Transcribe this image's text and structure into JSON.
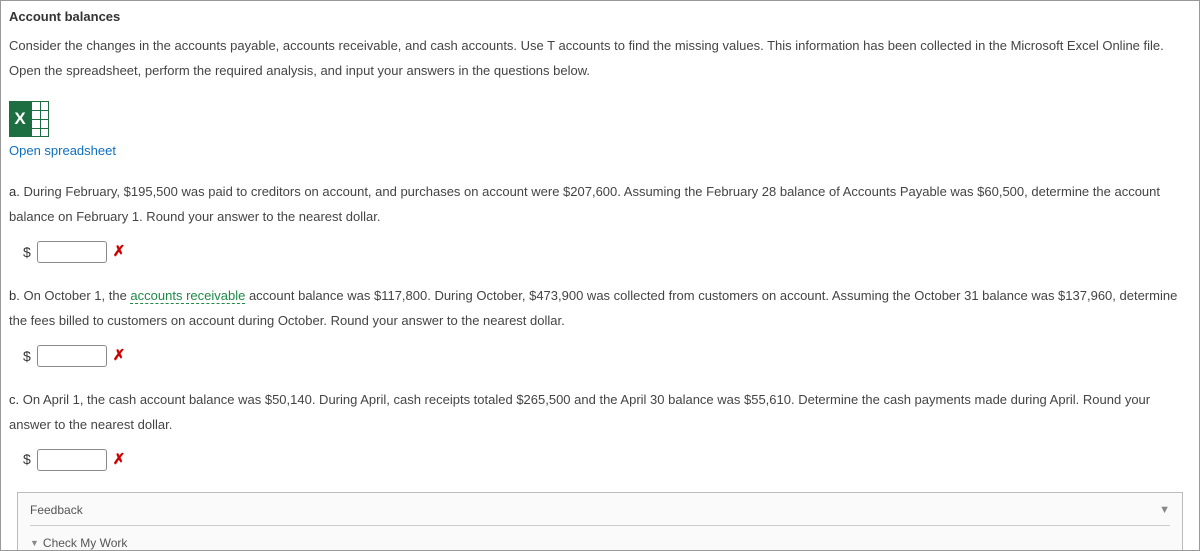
{
  "title": "Account balances",
  "intro": "Consider the changes in the accounts payable, accounts receivable, and cash accounts. Use T accounts to find the missing values. This information has been collected in the Microsoft Excel Online file. Open the spreadsheet, perform the required analysis, and input your answers in the questions below.",
  "excel": {
    "icon_letter": "X",
    "link_text": "Open spreadsheet"
  },
  "questions": {
    "a": {
      "label": "a.",
      "text_before": "During February, $195,500 was paid to creditors on account, and purchases on account were $207,600. Assuming the February 28 balance of Accounts Payable was $60,500, determine the account balance on February 1. Round your answer to the nearest dollar.",
      "currency": "$",
      "value": "",
      "mark": "✗"
    },
    "b": {
      "label": "b.",
      "text_before": "On October 1, the ",
      "term": "accounts receivable",
      "text_after": " account balance was $117,800. During October, $473,900 was collected from customers on account. Assuming the October 31 balance was $137,960, determine the fees billed to customers on account during October. Round your answer to the nearest dollar.",
      "currency": "$",
      "value": "",
      "mark": "✗"
    },
    "c": {
      "label": "c.",
      "text_before": "On April 1, the cash account balance was $50,140. During April, cash receipts totaled $265,500 and the April 30 balance was $55,610. Determine the cash payments made during April. Round your answer to the nearest dollar.",
      "currency": "$",
      "value": "",
      "mark": "✗"
    }
  },
  "feedback": {
    "header": "Feedback",
    "arrow": "▼",
    "check_tri": "▼",
    "check_label": "Check My Work"
  }
}
